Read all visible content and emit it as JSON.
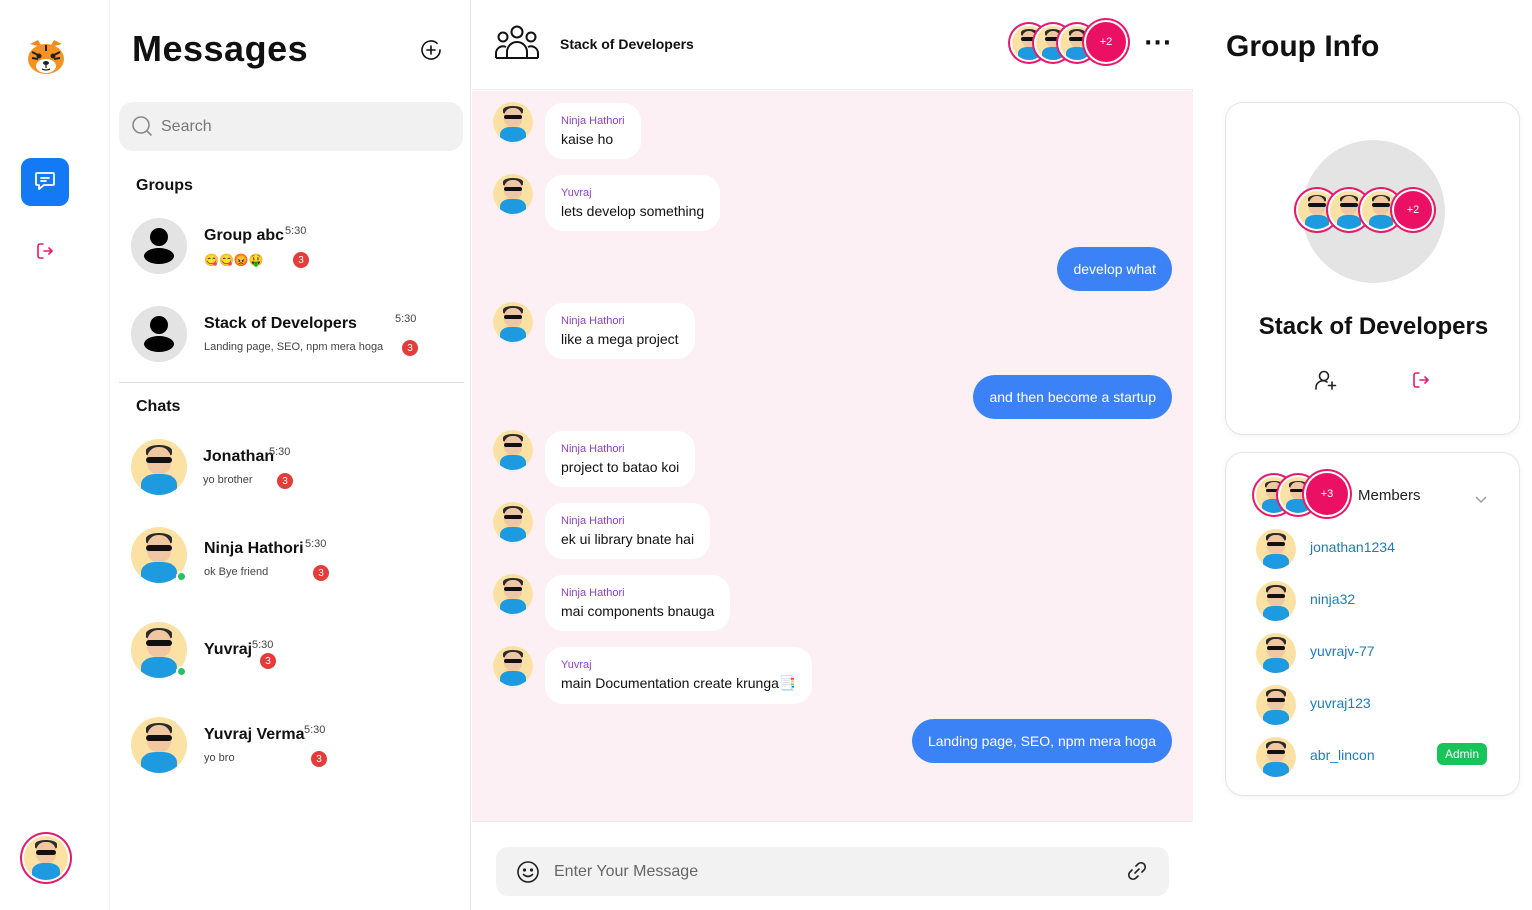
{
  "messages_panel": {
    "title": "Messages",
    "search_placeholder": "Search",
    "groups_label": "Groups",
    "chats_label": "Chats",
    "groups": [
      {
        "name": "Group abc",
        "time": "5:30",
        "preview": "😋😋😡🤑",
        "unread": "3"
      },
      {
        "name": "Stack of Developers",
        "time": "5:30",
        "preview": "Landing page, SEO, npm mera hoga",
        "unread": "3"
      }
    ],
    "chats": [
      {
        "name": "Jonathan",
        "time": "5:30",
        "preview": "yo brother",
        "unread": "3",
        "online": false
      },
      {
        "name": "Ninja Hathori",
        "time": "5:30",
        "preview": "ok Bye friend",
        "unread": "3",
        "online": true
      },
      {
        "name": "Yuvraj",
        "time": "5:30",
        "preview": "",
        "unread": "3",
        "online": true
      },
      {
        "name": "Yuvraj Verma",
        "time": "5:30",
        "preview": "yo bro",
        "unread": "3",
        "online": false
      }
    ]
  },
  "chat": {
    "title": "Stack of Developers",
    "header_extra_members": "+2",
    "composer_placeholder": "Enter Your Message",
    "messages": [
      {
        "sender": "Ninja Hathori",
        "text": "kaise ho",
        "mine": false
      },
      {
        "sender": "Yuvraj",
        "text": "lets develop something",
        "mine": false
      },
      {
        "sender": "",
        "text": "develop what",
        "mine": true
      },
      {
        "sender": "Ninja Hathori",
        "text": "like a mega project",
        "mine": false
      },
      {
        "sender": "",
        "text": "and then become a startup",
        "mine": true
      },
      {
        "sender": "Ninja Hathori",
        "text": "project to batao koi",
        "mine": false
      },
      {
        "sender": "Ninja Hathori",
        "text": "ek ui library bnate hai",
        "mine": false
      },
      {
        "sender": "Ninja Hathori",
        "text": "mai components bnauga",
        "mine": false
      },
      {
        "sender": "Yuvraj",
        "text": "main Documentation create krunga📑",
        "mine": false
      },
      {
        "sender": "",
        "text": "Landing page, SEO, npm mera hoga",
        "mine": true
      }
    ]
  },
  "group_info": {
    "title": "Group Info",
    "group_name": "Stack of Developers",
    "avatar_extra": "+2",
    "members_label": "Members",
    "members_extra": "+3",
    "members": [
      {
        "username": "jonathan1234",
        "role": ""
      },
      {
        "username": "ninja32",
        "role": ""
      },
      {
        "username": "yuvrajv-77",
        "role": ""
      },
      {
        "username": "yuvraj123",
        "role": ""
      },
      {
        "username": "abr_lincon",
        "role": "Admin"
      }
    ]
  },
  "colors": {
    "accent_blue": "#3b82f6",
    "rail_active": "#1479f5",
    "pink": "#ec1064",
    "chat_bg": "#fdf0f5",
    "sender_purple": "#8a3fd1",
    "badge_red": "#e63b3b",
    "online_green": "#22c55e",
    "admin_green": "#16c45a"
  },
  "icons": [
    "tiger-logo-icon",
    "chat-icon",
    "logout-icon",
    "add-circle-icon",
    "search-icon",
    "group-icon",
    "more-icon",
    "emoji-icon",
    "attach-icon",
    "add-user-icon",
    "chevron-down-icon"
  ]
}
